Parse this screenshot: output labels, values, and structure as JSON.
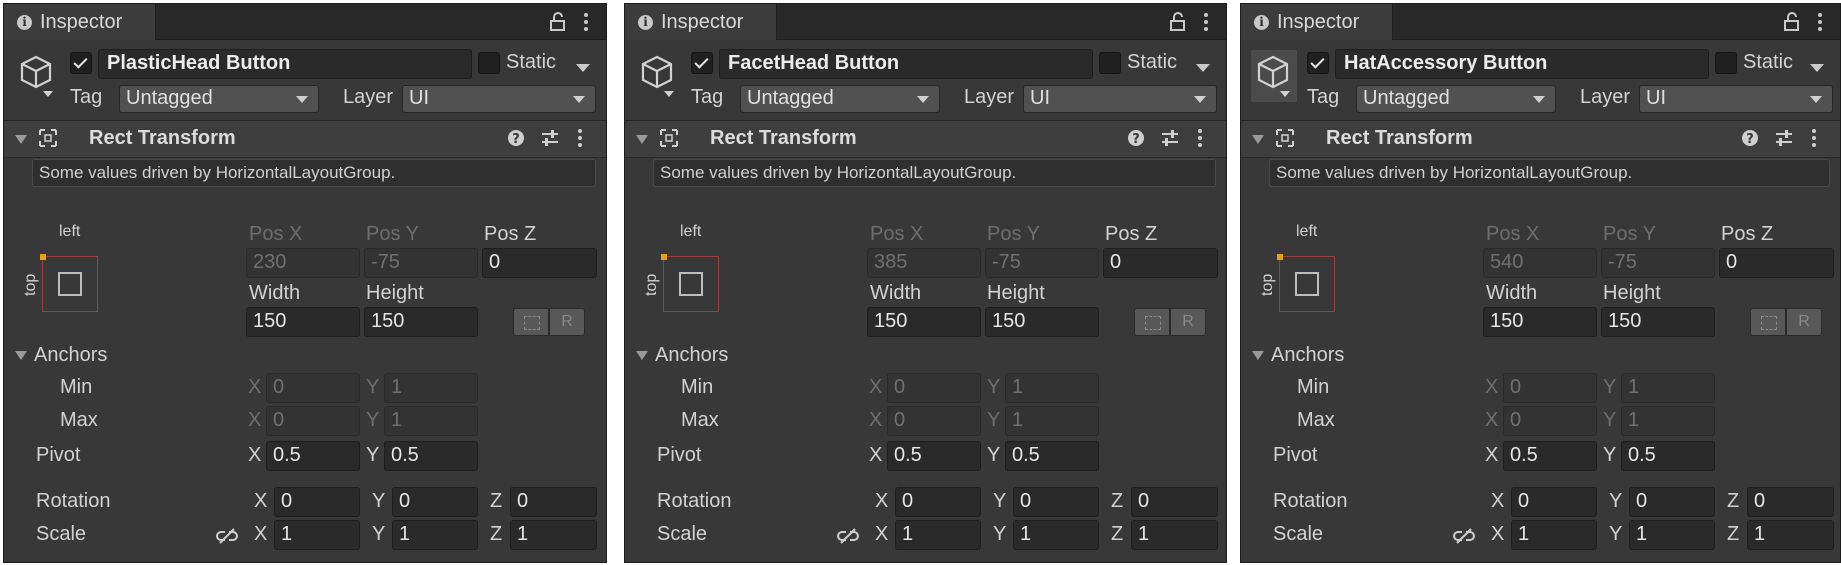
{
  "panels": [
    {
      "tab_label": "Inspector",
      "go_name": "PlasticHead Button",
      "static_label": "Static",
      "tag_label": "Tag",
      "tag_value": "Untagged",
      "layer_label": "Layer",
      "layer_value": "UI",
      "component_title": "Rect Transform",
      "info_text": "Some values driven by HorizontalLayoutGroup.",
      "anchor_h": "left",
      "anchor_v": "top",
      "pos_x_label": "Pos X",
      "pos_x": "230",
      "pos_y_label": "Pos Y",
      "pos_y": "-75",
      "pos_z_label": "Pos Z",
      "pos_z": "0",
      "width_label": "Width",
      "width": "150",
      "height_label": "Height",
      "height": "150",
      "raw_btn": "R",
      "anchors_label": "Anchors",
      "min_label": "Min",
      "min_x": "0",
      "min_y": "1",
      "max_label": "Max",
      "max_x": "0",
      "max_y": "1",
      "pivot_label": "Pivot",
      "pivot_x": "0.5",
      "pivot_y": "0.5",
      "rotation_label": "Rotation",
      "rot_x": "0",
      "rot_y": "0",
      "rot_z": "0",
      "scale_label": "Scale",
      "scale_x": "1",
      "scale_y": "1",
      "scale_z": "1",
      "x": "X",
      "y": "Y",
      "z": "Z",
      "icon_selected": false
    },
    {
      "tab_label": "Inspector",
      "go_name": "FacetHead Button",
      "static_label": "Static",
      "tag_label": "Tag",
      "tag_value": "Untagged",
      "layer_label": "Layer",
      "layer_value": "UI",
      "component_title": "Rect Transform",
      "info_text": "Some values driven by HorizontalLayoutGroup.",
      "anchor_h": "left",
      "anchor_v": "top",
      "pos_x_label": "Pos X",
      "pos_x": "385",
      "pos_y_label": "Pos Y",
      "pos_y": "-75",
      "pos_z_label": "Pos Z",
      "pos_z": "0",
      "width_label": "Width",
      "width": "150",
      "height_label": "Height",
      "height": "150",
      "raw_btn": "R",
      "anchors_label": "Anchors",
      "min_label": "Min",
      "min_x": "0",
      "min_y": "1",
      "max_label": "Max",
      "max_x": "0",
      "max_y": "1",
      "pivot_label": "Pivot",
      "pivot_x": "0.5",
      "pivot_y": "0.5",
      "rotation_label": "Rotation",
      "rot_x": "0",
      "rot_y": "0",
      "rot_z": "0",
      "scale_label": "Scale",
      "scale_x": "1",
      "scale_y": "1",
      "scale_z": "1",
      "x": "X",
      "y": "Y",
      "z": "Z",
      "icon_selected": false
    },
    {
      "tab_label": "Inspector",
      "go_name": "HatAccessory Button",
      "static_label": "Static",
      "tag_label": "Tag",
      "tag_value": "Untagged",
      "layer_label": "Layer",
      "layer_value": "UI",
      "component_title": "Rect Transform",
      "info_text": "Some values driven by HorizontalLayoutGroup.",
      "anchor_h": "left",
      "anchor_v": "top",
      "pos_x_label": "Pos X",
      "pos_x": "540",
      "pos_y_label": "Pos Y",
      "pos_y": "-75",
      "pos_z_label": "Pos Z",
      "pos_z": "0",
      "width_label": "Width",
      "width": "150",
      "height_label": "Height",
      "height": "150",
      "raw_btn": "R",
      "anchors_label": "Anchors",
      "min_label": "Min",
      "min_x": "0",
      "min_y": "1",
      "max_label": "Max",
      "max_x": "0",
      "max_y": "1",
      "pivot_label": "Pivot",
      "pivot_x": "0.5",
      "pivot_y": "0.5",
      "rotation_label": "Rotation",
      "rot_x": "0",
      "rot_y": "0",
      "rot_z": "0",
      "scale_label": "Scale",
      "scale_x": "1",
      "scale_y": "1",
      "scale_z": "1",
      "x": "X",
      "y": "Y",
      "z": "Z",
      "icon_selected": true
    }
  ]
}
